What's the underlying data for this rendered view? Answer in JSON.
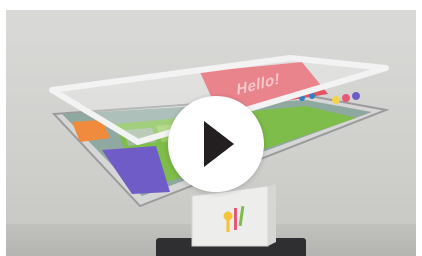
{
  "screen": {
    "hello_text": "Hello!"
  },
  "player": {
    "play_icon": "play-icon"
  },
  "colors": {
    "hello_tile": "#e15562",
    "green_panel": "#7fbd4a",
    "purple_panel": "#6f5cc7",
    "pedestal": "#ededec",
    "play_button": "#ffffff"
  }
}
